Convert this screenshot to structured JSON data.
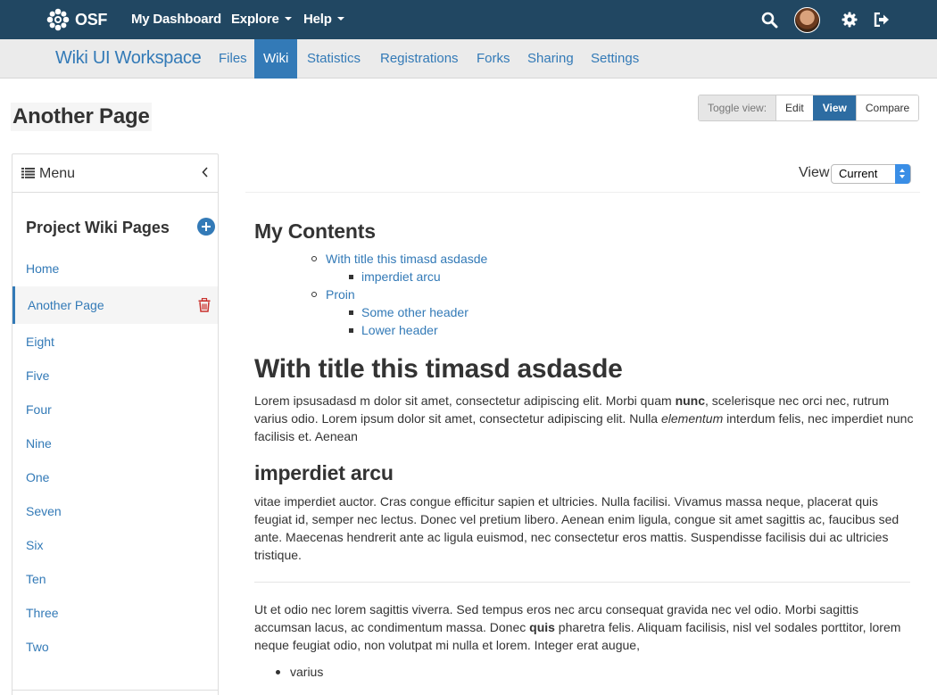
{
  "topnav": {
    "brand": "OSF",
    "links": [
      {
        "label": "My Dashboard"
      },
      {
        "label": "Explore"
      },
      {
        "label": "Help"
      }
    ]
  },
  "project": {
    "title": "Wiki UI Workspace",
    "tabs": [
      {
        "label": "Files"
      },
      {
        "label": "Wiki"
      },
      {
        "label": "Statistics"
      },
      {
        "label": "Registrations"
      },
      {
        "label": "Forks"
      },
      {
        "label": "Sharing"
      },
      {
        "label": "Settings"
      }
    ],
    "active_tab": "Wiki"
  },
  "page_title": "Another Page",
  "toggle": {
    "label": "Toggle view:",
    "buttons": [
      "Edit",
      "View",
      "Compare"
    ],
    "active": "View"
  },
  "sidebar": {
    "menu_label": "Menu",
    "heading": "Project Wiki Pages",
    "pages": [
      "Home",
      "Another Page",
      "Eight",
      "Five",
      "Four",
      "Nine",
      "One",
      "Seven",
      "Six",
      "Ten",
      "Three",
      "Two"
    ],
    "active_page": "Another Page"
  },
  "view": {
    "label": "View",
    "selected": "Current"
  },
  "content": {
    "toc_title": "My Contents",
    "toc": [
      {
        "label": "With title this timasd asdasde",
        "children": [
          "imperdiet arcu"
        ]
      },
      {
        "label": "Proin",
        "children": [
          "Some other header",
          "Lower header"
        ]
      }
    ],
    "h1": "With title this timasd asdasde",
    "p1": {
      "a": "Lorem ipsusadasd m dolor sit amet, consectetur adipiscing elit. Morbi quam ",
      "b": "nunc",
      "c": ", scelerisque nec orci nec, rutrum varius odio. Lorem ipsum dolor sit amet, consectetur adipiscing elit. Nulla ",
      "d": "elementum",
      "e": " interdum felis, nec imperdiet nunc facilisis et. Aenean"
    },
    "h2": "imperdiet arcu",
    "p2": "vitae imperdiet auctor. Cras congue efficitur sapien et ultricies. Nulla facilisi. Vivamus massa neque, placerat quis feugiat id, semper nec lectus. Donec vel pretium libero. Aenean enim ligula, congue sit amet sagittis ac, faucibus sed ante. Maecenas hendrerit ante ac ligula euismod, nec consectetur eros mattis. Suspendisse facilisis dui ac ultricies tristique.",
    "p3": {
      "a": "Ut et odio nec lorem sagittis viverra. Sed tempus eros nec arcu consequat gravida nec vel odio. Morbi sagittis accumsan lacus, ac condimentum massa. Donec ",
      "b": "quis",
      "c": " pharetra felis. Aliquam facilisis, nisl vel sodales porttitor, lorem neque feugiat odio, non volutpat mi nulla et lorem. Integer erat augue,"
    },
    "bullet": "varius"
  }
}
